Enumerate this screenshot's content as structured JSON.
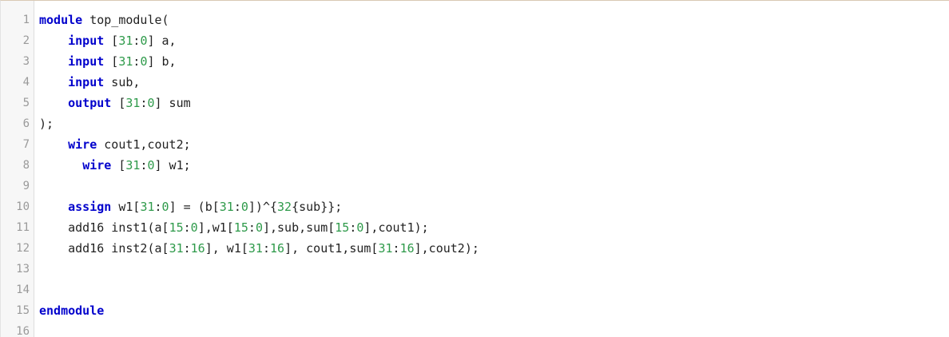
{
  "editor": {
    "language": "verilog",
    "colors": {
      "keyword": "#0000cc",
      "number": "#2e9a4a",
      "text": "#222222",
      "line_number": "#9a9a9a"
    },
    "lines": [
      {
        "n": "1",
        "tokens": [
          [
            "kw",
            "module"
          ],
          [
            "t",
            " top_module("
          ]
        ]
      },
      {
        "n": "2",
        "tokens": [
          [
            "t",
            "    "
          ],
          [
            "kw",
            "input"
          ],
          [
            "t",
            " ["
          ],
          [
            "num",
            "31"
          ],
          [
            "t",
            ":"
          ],
          [
            "num",
            "0"
          ],
          [
            "t",
            "] a,"
          ]
        ]
      },
      {
        "n": "3",
        "tokens": [
          [
            "t",
            "    "
          ],
          [
            "kw",
            "input"
          ],
          [
            "t",
            " ["
          ],
          [
            "num",
            "31"
          ],
          [
            "t",
            ":"
          ],
          [
            "num",
            "0"
          ],
          [
            "t",
            "] b,"
          ]
        ]
      },
      {
        "n": "4",
        "tokens": [
          [
            "t",
            "    "
          ],
          [
            "kw",
            "input"
          ],
          [
            "t",
            " sub,"
          ]
        ]
      },
      {
        "n": "5",
        "tokens": [
          [
            "t",
            "    "
          ],
          [
            "kw",
            "output"
          ],
          [
            "t",
            " ["
          ],
          [
            "num",
            "31"
          ],
          [
            "t",
            ":"
          ],
          [
            "num",
            "0"
          ],
          [
            "t",
            "] sum"
          ]
        ]
      },
      {
        "n": "6",
        "tokens": [
          [
            "t",
            ");"
          ]
        ]
      },
      {
        "n": "7",
        "tokens": [
          [
            "t",
            "    "
          ],
          [
            "kw",
            "wire"
          ],
          [
            "t",
            " cout1,cout2;"
          ]
        ]
      },
      {
        "n": "8",
        "tokens": [
          [
            "t",
            "      "
          ],
          [
            "kw",
            "wire"
          ],
          [
            "t",
            " ["
          ],
          [
            "num",
            "31"
          ],
          [
            "t",
            ":"
          ],
          [
            "num",
            "0"
          ],
          [
            "t",
            "] w1;"
          ]
        ]
      },
      {
        "n": "9",
        "tokens": []
      },
      {
        "n": "10",
        "tokens": [
          [
            "t",
            "    "
          ],
          [
            "kw",
            "assign"
          ],
          [
            "t",
            " w1["
          ],
          [
            "num",
            "31"
          ],
          [
            "t",
            ":"
          ],
          [
            "num",
            "0"
          ],
          [
            "t",
            "] = (b["
          ],
          [
            "num",
            "31"
          ],
          [
            "t",
            ":"
          ],
          [
            "num",
            "0"
          ],
          [
            "t",
            "])^{"
          ],
          [
            "num",
            "32"
          ],
          [
            "t",
            "{sub}};"
          ]
        ]
      },
      {
        "n": "11",
        "tokens": [
          [
            "t",
            "    add16 inst1(a["
          ],
          [
            "num",
            "15"
          ],
          [
            "t",
            ":"
          ],
          [
            "num",
            "0"
          ],
          [
            "t",
            "],w1["
          ],
          [
            "num",
            "15"
          ],
          [
            "t",
            ":"
          ],
          [
            "num",
            "0"
          ],
          [
            "t",
            "],sub,sum["
          ],
          [
            "num",
            "15"
          ],
          [
            "t",
            ":"
          ],
          [
            "num",
            "0"
          ],
          [
            "t",
            "],cout1);"
          ]
        ]
      },
      {
        "n": "12",
        "tokens": [
          [
            "t",
            "    add16 inst2(a["
          ],
          [
            "num",
            "31"
          ],
          [
            "t",
            ":"
          ],
          [
            "num",
            "16"
          ],
          [
            "t",
            "], w1["
          ],
          [
            "num",
            "31"
          ],
          [
            "t",
            ":"
          ],
          [
            "num",
            "16"
          ],
          [
            "t",
            "], cout1,sum["
          ],
          [
            "num",
            "31"
          ],
          [
            "t",
            ":"
          ],
          [
            "num",
            "16"
          ],
          [
            "t",
            "],cout2);"
          ]
        ]
      },
      {
        "n": "13",
        "tokens": []
      },
      {
        "n": "14",
        "tokens": []
      },
      {
        "n": "15",
        "tokens": [
          [
            "kw",
            "endmodule"
          ]
        ]
      },
      {
        "n": "16",
        "tokens": []
      }
    ]
  }
}
